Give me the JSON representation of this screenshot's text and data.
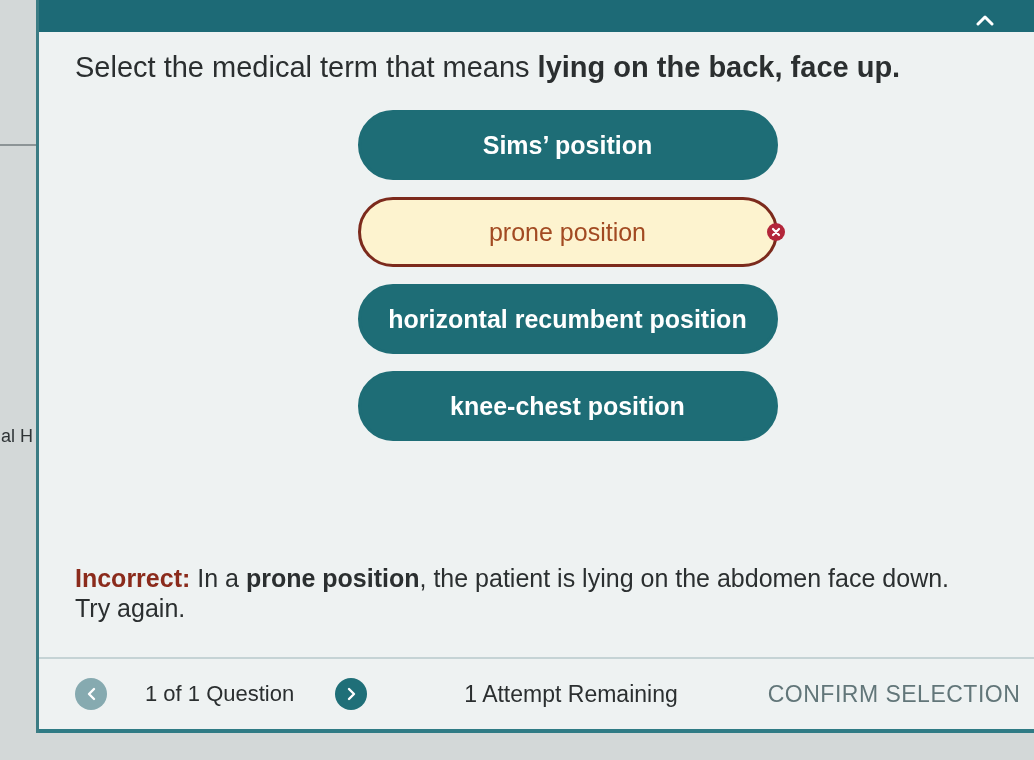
{
  "background_page": {
    "text": "al H"
  },
  "question": {
    "text": "Select the medical term that means **lying on the back, face up.**"
  },
  "options": [
    {
      "label": "Sims’ position",
      "selected": false,
      "incorrect": false
    },
    {
      "label": "prone position",
      "selected": true,
      "incorrect": true
    },
    {
      "label": "horizontal recumbent position",
      "selected": false,
      "incorrect": false
    },
    {
      "label": "knee-chest position",
      "selected": false,
      "incorrect": false
    }
  ],
  "feedback": {
    "kind": "incorrect",
    "text": "**Incorrect:** In a **prone position**, the patient is lying on the abdomen face down.",
    "retry": "Try again."
  },
  "footer": {
    "prev_button": {
      "disabled": true
    },
    "counter": "1 of 1 Question",
    "next_button": {
      "disabled": false
    },
    "attempts": "1 Attempt Remaining",
    "confirm_button": {
      "label": "CONFIRM SELECTION",
      "disabled": true
    }
  }
}
